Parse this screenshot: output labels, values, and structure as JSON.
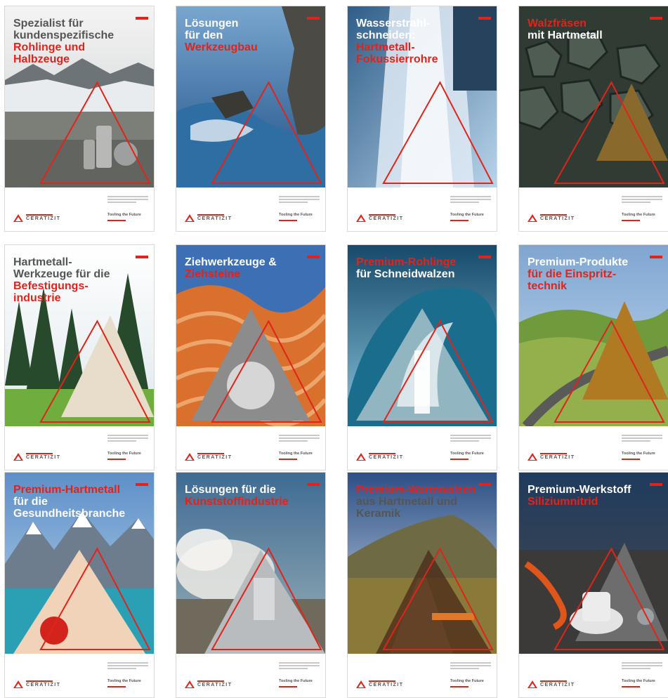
{
  "brand": {
    "logo_text": "CERATIZIT",
    "slogan": "Tooling the Future",
    "accent_color": "#e2231a",
    "dark_text_color": "#555555",
    "light_text_color": "#ffffff"
  },
  "posters": [
    {
      "theme": "glacier-landscape",
      "headline_lines": [
        {
          "text": "Spezialist für",
          "color": "dark"
        },
        {
          "text": "kundenspezifische",
          "color": "dark"
        },
        {
          "text": "Rohlinge und",
          "color": "red"
        },
        {
          "text": "Halbzeuge",
          "color": "red"
        }
      ]
    },
    {
      "theme": "ocean-cliffs",
      "headline_lines": [
        {
          "text": "Lösungen",
          "color": "light"
        },
        {
          "text": "für den",
          "color": "light"
        },
        {
          "text": "Werkzeugbau",
          "color": "red"
        }
      ]
    },
    {
      "theme": "waterfall",
      "headline_lines": [
        {
          "text": "Wasserstrahl-",
          "color": "light"
        },
        {
          "text": "schneiden:",
          "color": "light"
        },
        {
          "text": "Hartmetall-",
          "color": "red"
        },
        {
          "text": "Fokussierrohre",
          "color": "red"
        }
      ]
    },
    {
      "theme": "basalt-columns",
      "headline_lines": [
        {
          "text": "Walzfräsen",
          "color": "red"
        },
        {
          "text": "mit Hartmetall",
          "color": "light"
        }
      ]
    },
    {
      "theme": "pine-forest",
      "headline_lines": [
        {
          "text": "Hartmetall-",
          "color": "dark"
        },
        {
          "text": "Werkzeuge für die",
          "color": "dark"
        },
        {
          "text": "Befestigungs-",
          "color": "red"
        },
        {
          "text": "industrie",
          "color": "red"
        }
      ]
    },
    {
      "theme": "sandstone-waves",
      "headline_lines": [
        {
          "text": "Ziehwerkzeuge &",
          "color": "light"
        },
        {
          "text": "Ziehsteine",
          "color": "red"
        }
      ]
    },
    {
      "theme": "ocean-wave",
      "headline_lines": [
        {
          "text": "Premium-Rohlinge",
          "color": "red"
        },
        {
          "text": "für Schneidwalzen",
          "color": "light"
        }
      ]
    },
    {
      "theme": "mountain-road",
      "headline_lines": [
        {
          "text": "Premium-Produkte",
          "color": "light"
        },
        {
          "text": "für die Einspritz-",
          "color": "red"
        },
        {
          "text": "technik",
          "color": "red"
        }
      ]
    },
    {
      "theme": "alpine-lake",
      "headline_lines": [
        {
          "text": "Premium-Hartmetall",
          "color": "red"
        },
        {
          "text": "für die",
          "color": "light"
        },
        {
          "text": "Gesundheitsbranche",
          "color": "light"
        }
      ]
    },
    {
      "theme": "geyser-steam",
      "headline_lines": [
        {
          "text": "Lösungen für die",
          "color": "light"
        },
        {
          "text": "Kunststoffindustrie",
          "color": "red"
        }
      ]
    },
    {
      "theme": "wooden-path",
      "headline_lines": [
        {
          "text": "Premium-Warmwalzen",
          "color": "red"
        },
        {
          "text": "aus Hartmetall und",
          "color": "dark"
        },
        {
          "text": "Keramik",
          "color": "dark"
        }
      ]
    },
    {
      "theme": "volcano-lava",
      "headline_lines": [
        {
          "text": "Premium-Werkstoff",
          "color": "light"
        },
        {
          "text": "Siliziumnitrid",
          "color": "red"
        }
      ]
    }
  ]
}
